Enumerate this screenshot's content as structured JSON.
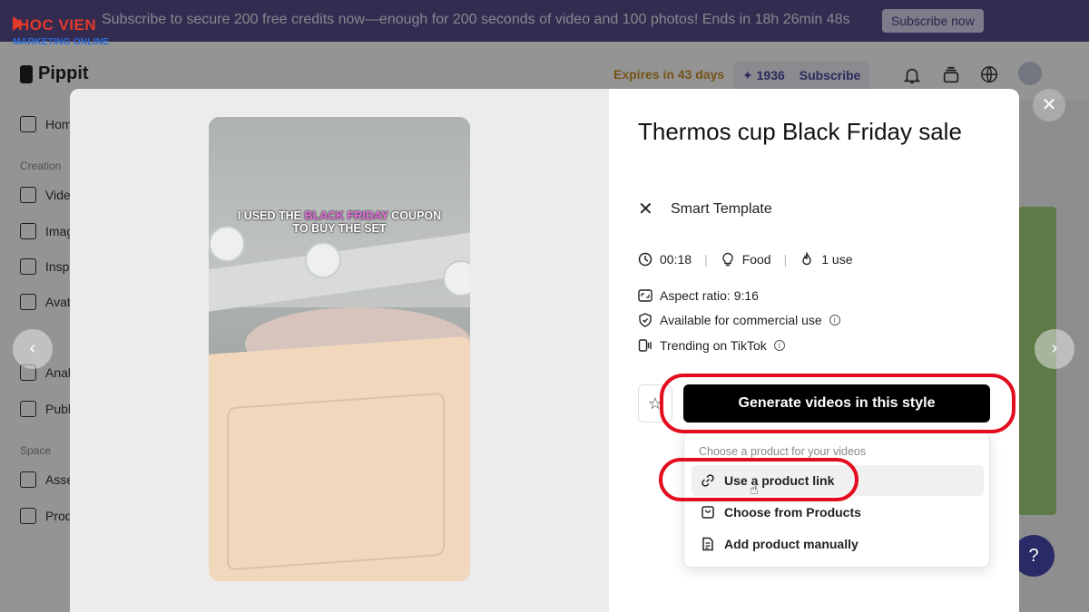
{
  "promo": {
    "text": "Subscribe to secure 200 free credits now—enough for 200 seconds of video and 100 photos! Ends in 18h 26min 48s",
    "button": "Subscribe now"
  },
  "watermark": {
    "line1": "HOC VIEN",
    "line2": "MARKETING ONLINE"
  },
  "header": {
    "logo": "Pippit",
    "expires": "Expires in 43 days",
    "credits": "✦ 1936",
    "subscribe": "Subscribe",
    "icons": [
      "bell-icon",
      "stack-icon",
      "language-en-icon"
    ]
  },
  "sidebar": {
    "items": [
      {
        "label": "Hom",
        "icon": "home-icon"
      },
      {
        "label": "Vide",
        "icon": "video-add-icon"
      },
      {
        "label": "Imag",
        "icon": "image-add-icon"
      },
      {
        "label": "Insp",
        "icon": "inspiration-icon"
      },
      {
        "label": "Avat",
        "icon": "avatar-icon"
      },
      {
        "label": "Anal",
        "icon": "analytics-icon"
      },
      {
        "label": "Publ",
        "icon": "publisher-icon"
      },
      {
        "label": "Asse",
        "icon": "assets-icon"
      },
      {
        "label": "Prod",
        "icon": "products-icon"
      }
    ],
    "sections": [
      "Creation",
      "Space"
    ]
  },
  "modal": {
    "title": "Thermos cup Black Friday sale",
    "template_label": "Smart Template",
    "duration": "00:18",
    "category": "Food",
    "uses": "1 use",
    "aspect_ratio": "Aspect ratio: 9:16",
    "commercial": "Available for commercial use",
    "trending": "Trending on TikTok",
    "generate_button": "Generate videos in this style",
    "dropdown_heading": "Choose a product for your videos",
    "dropdown_items": [
      {
        "label": "Use a product link",
        "icon": "link-icon"
      },
      {
        "label": "Choose from Products",
        "icon": "product-box-icon"
      },
      {
        "label": "Add product manually",
        "icon": "document-icon"
      }
    ],
    "caption": {
      "part1": "I USED THE ",
      "highlight": "BLACK FRIDAY",
      "part2": " COUPON",
      "line2": "TO BUY THE SET"
    }
  },
  "colors": {
    "promo_bg": "#5a4a8c",
    "highlight_ring": "#e30d1f",
    "primary_button": "#000000",
    "expires_text": "#c9902a"
  }
}
